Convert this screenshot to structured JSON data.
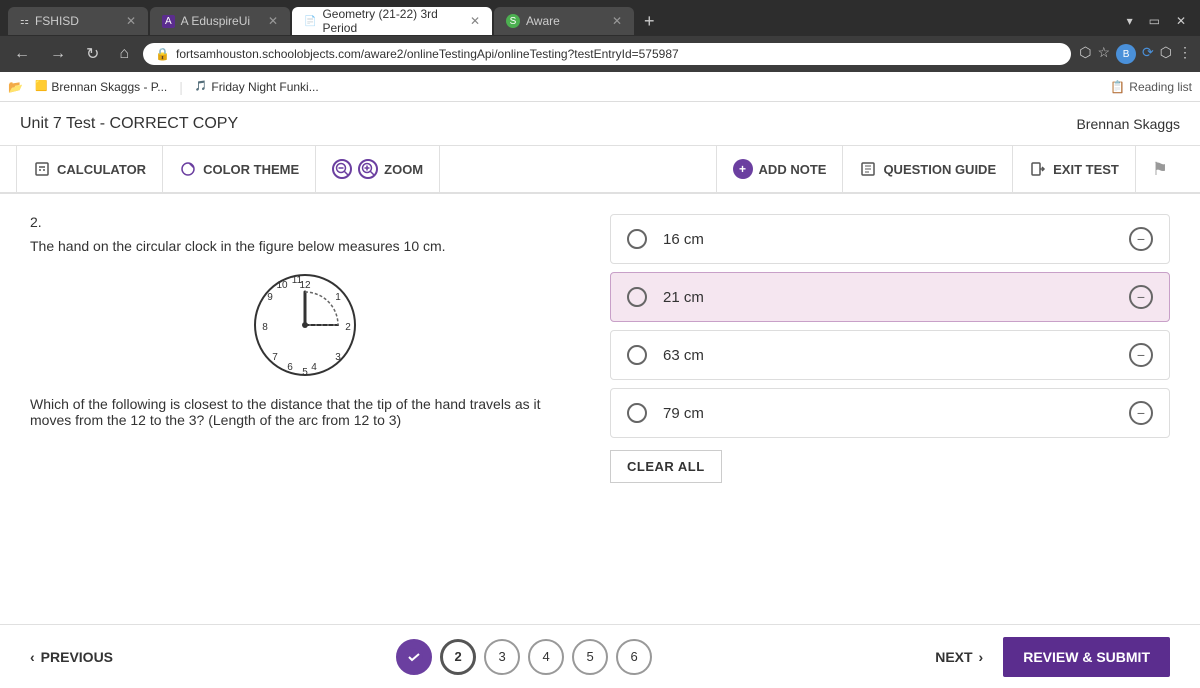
{
  "browser": {
    "tabs": [
      {
        "label": "FSHISD",
        "active": false,
        "icon": "grid"
      },
      {
        "label": "A  EduspireUi",
        "active": false,
        "icon": "A"
      },
      {
        "label": "Geometry (21-22) 3rd Period",
        "active": true,
        "icon": "doc"
      },
      {
        "label": "Aware",
        "active": false,
        "icon": "A"
      }
    ],
    "url": "fortsamhouston.schoolobjects.com/aware2/onlineTestingApi/onlineTesting?testEntryId=575987",
    "bookmarks": [
      {
        "label": "Brennan Skaggs - P..."
      },
      {
        "label": "Friday Night Funki..."
      }
    ],
    "reading_list": "Reading list"
  },
  "test": {
    "title": "Unit 7 Test - CORRECT COPY",
    "user": "Brennan Skaggs",
    "toolbar": {
      "calculator_label": "CALCULATOR",
      "color_theme_label": "COLOR THEME",
      "zoom_label": "ZOOM",
      "add_note_label": "ADD NOTE",
      "question_guide_label": "QUESTION GUIDE",
      "exit_test_label": "EXIT TEST"
    }
  },
  "question": {
    "number": "2.",
    "text": "The hand on the circular clock in the figure below measures 10 cm.",
    "sub_text": "Which of the following is closest to the distance that the tip of the hand travels as it moves from the 12 to the 3?  (Length of the arc from 12 to 3)",
    "answers": [
      {
        "label": "16 cm",
        "selected": false
      },
      {
        "label": "21 cm",
        "selected": true
      },
      {
        "label": "63 cm",
        "selected": false
      },
      {
        "label": "79 cm",
        "selected": false
      }
    ],
    "clear_all": "CLEAR ALL"
  },
  "navigation": {
    "previous": "PREVIOUS",
    "next": "NEXT",
    "review_submit": "REVIEW & SUBMIT",
    "question_dots": [
      {
        "number": "1",
        "state": "answered"
      },
      {
        "number": "2",
        "state": "current"
      },
      {
        "number": "3",
        "state": "unanswered"
      },
      {
        "number": "4",
        "state": "unanswered"
      },
      {
        "number": "5",
        "state": "unanswered"
      },
      {
        "number": "6",
        "state": "unanswered"
      }
    ]
  }
}
